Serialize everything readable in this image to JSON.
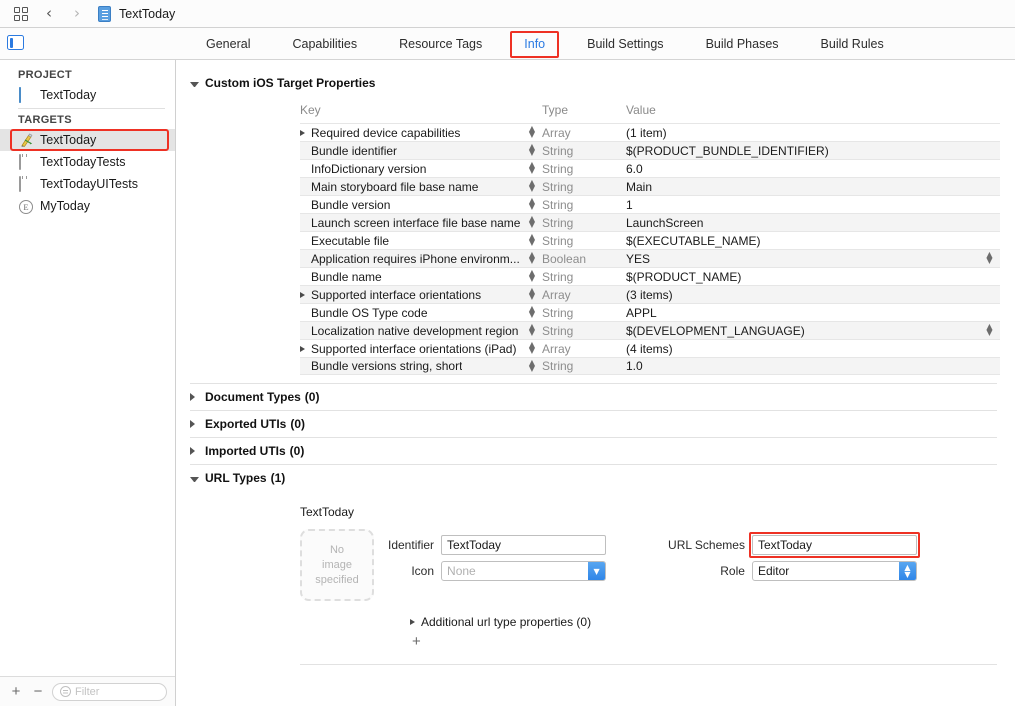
{
  "jumpbar": {
    "grid_icon": "grid-icon",
    "back_icon": "chevron-left-icon",
    "forward_icon": "chevron-right-icon",
    "file_icon": "project-file-icon",
    "title": "TextToday"
  },
  "tabbar": {
    "panel_toggle_icon": "navigator-toggle-icon",
    "tabs": [
      {
        "label": "General",
        "selected": false
      },
      {
        "label": "Capabilities",
        "selected": false
      },
      {
        "label": "Resource Tags",
        "selected": false
      },
      {
        "label": "Info",
        "selected": true
      },
      {
        "label": "Build Settings",
        "selected": false
      },
      {
        "label": "Build Phases",
        "selected": false
      },
      {
        "label": "Build Rules",
        "selected": false
      }
    ],
    "highlight_color": "#ee3124",
    "selected_color": "#2a7ae2"
  },
  "sidebar": {
    "project_header": "PROJECT",
    "project_items": [
      {
        "label": "TextToday",
        "icon": "project-icon"
      }
    ],
    "targets_header": "TARGETS",
    "target_items": [
      {
        "label": "TextToday",
        "icon": "app-target-icon",
        "selected": true,
        "highlighted": true
      },
      {
        "label": "TextTodayTests",
        "icon": "test-target-icon",
        "selected": false,
        "highlighted": false
      },
      {
        "label": "TextTodayUITests",
        "icon": "test-target-icon",
        "selected": false,
        "highlighted": false
      },
      {
        "label": "MyToday",
        "icon": "extension-target-icon",
        "selected": false,
        "highlighted": false
      }
    ],
    "footer": {
      "add_label": "+",
      "remove_label": "−",
      "filter_icon": "filter-icon",
      "filter_placeholder": "Filter"
    }
  },
  "editor": {
    "custom_properties": {
      "title": "Custom iOS Target Properties",
      "expanded": true,
      "columns": {
        "key": "Key",
        "type": "Type",
        "value": "Value"
      },
      "rows": [
        {
          "key": "Required device capabilities",
          "type": "Array",
          "value": "(1 item)",
          "expandable": true,
          "value_stepper": false
        },
        {
          "key": "Bundle identifier",
          "type": "String",
          "value": "$(PRODUCT_BUNDLE_IDENTIFIER)",
          "expandable": false,
          "value_stepper": false
        },
        {
          "key": "InfoDictionary version",
          "type": "String",
          "value": "6.0",
          "expandable": false,
          "value_stepper": false
        },
        {
          "key": "Main storyboard file base name",
          "type": "String",
          "value": "Main",
          "expandable": false,
          "value_stepper": false
        },
        {
          "key": "Bundle version",
          "type": "String",
          "value": "1",
          "expandable": false,
          "value_stepper": false
        },
        {
          "key": "Launch screen interface file base name",
          "type": "String",
          "value": "LaunchScreen",
          "expandable": false,
          "value_stepper": false
        },
        {
          "key": "Executable file",
          "type": "String",
          "value": "$(EXECUTABLE_NAME)",
          "expandable": false,
          "value_stepper": false
        },
        {
          "key": "Application requires iPhone environm...",
          "type": "Boolean",
          "value": "YES",
          "expandable": false,
          "value_stepper": true
        },
        {
          "key": "Bundle name",
          "type": "String",
          "value": "$(PRODUCT_NAME)",
          "expandable": false,
          "value_stepper": false
        },
        {
          "key": "Supported interface orientations",
          "type": "Array",
          "value": "(3 items)",
          "expandable": true,
          "value_stepper": false
        },
        {
          "key": "Bundle OS Type code",
          "type": "String",
          "value": "APPL",
          "expandable": false,
          "value_stepper": false
        },
        {
          "key": "Localization native development region",
          "type": "String",
          "value": "$(DEVELOPMENT_LANGUAGE)",
          "expandable": false,
          "value_stepper": true
        },
        {
          "key": "Supported interface orientations (iPad)",
          "type": "Array",
          "value": "(4 items)",
          "expandable": true,
          "value_stepper": false
        },
        {
          "key": "Bundle versions string, short",
          "type": "String",
          "value": "1.0",
          "expandable": false,
          "value_stepper": false
        }
      ]
    },
    "sections": [
      {
        "title": "Document Types",
        "count": "(0)",
        "expanded": false
      },
      {
        "title": "Exported UTIs",
        "count": "(0)",
        "expanded": false
      },
      {
        "title": "Imported UTIs",
        "count": "(0)",
        "expanded": false
      }
    ],
    "url_types": {
      "title": "URL Types",
      "count": "(1)",
      "expanded": true,
      "entry_name": "TextToday",
      "image_well_text": [
        "No",
        "image",
        "specified"
      ],
      "identifier_label": "Identifier",
      "identifier_value": "TextToday",
      "icon_label": "Icon",
      "icon_placeholder": "None",
      "url_schemes_label": "URL Schemes",
      "url_schemes_value": "TextToday",
      "url_schemes_highlighted": true,
      "role_label": "Role",
      "role_value": "Editor",
      "additional_label": "Additional url type properties (0)",
      "add_label": "+"
    }
  }
}
